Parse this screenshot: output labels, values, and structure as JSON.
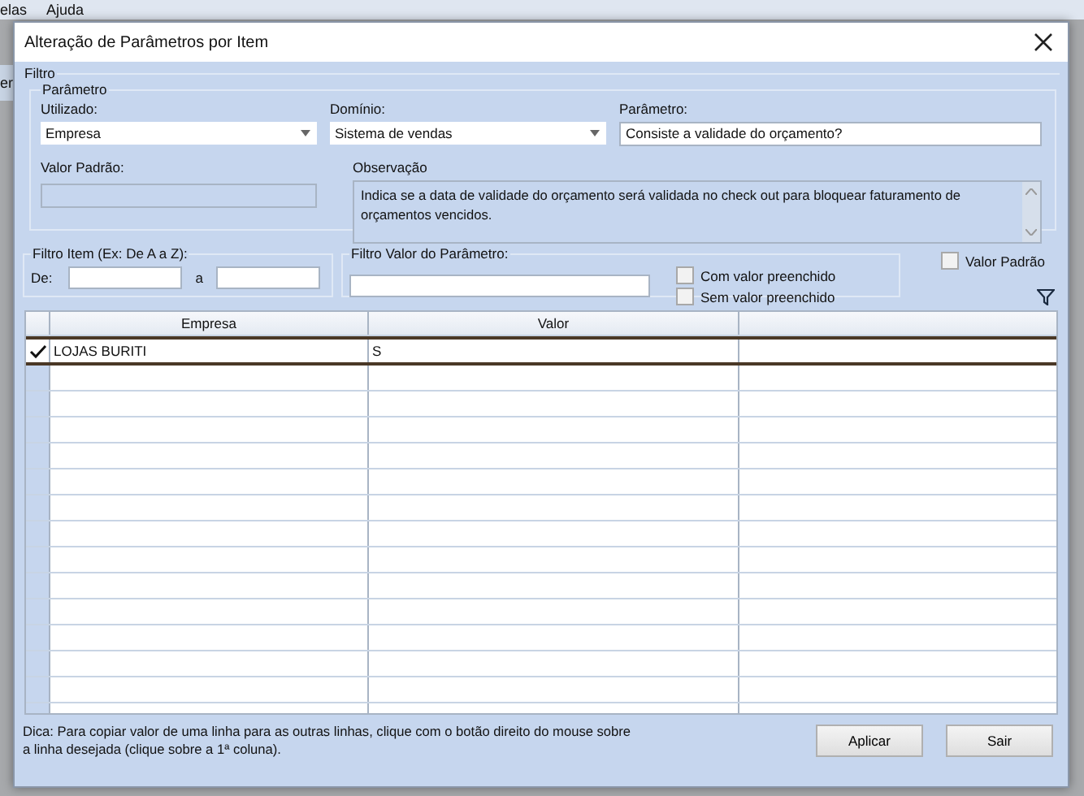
{
  "background_menu": [
    "elas",
    "Ajuda"
  ],
  "background_side_text": "er",
  "window": {
    "title": "Alteração de Parâmetros por Item"
  },
  "filtro": {
    "label": "Filtro",
    "parametro": {
      "label": "Parâmetro",
      "utilizado": {
        "label": "Utilizado:",
        "value": "Empresa"
      },
      "dominio": {
        "label": "Domínio:",
        "value": "Sistema de vendas"
      },
      "parametro_field": {
        "label": "Parâmetro:",
        "value": "Consiste a validade do orçamento?"
      },
      "valor_padrao": {
        "label": "Valor Padrão:",
        "disabled": true
      },
      "observacao": {
        "label": "Observação",
        "value": "Indica se a data de validade do orçamento será validada no check out para bloquear faturamento de orçamentos vencidos."
      }
    }
  },
  "filtro_item": {
    "label": "Filtro Item (Ex: De A a Z):",
    "de_label": "De:",
    "a_label": "a"
  },
  "filtro_valor": {
    "label": "Filtro Valor do Parâmetro:",
    "options": [
      {
        "label": "Com valor preenchido",
        "checked": false
      },
      {
        "label": "Sem valor preenchido",
        "checked": false
      }
    ]
  },
  "valor_padrao_check": {
    "label": "Valor Padrão",
    "checked": false
  },
  "table": {
    "columns": [
      "Empresa",
      "Valor"
    ],
    "rows": [
      {
        "cells": [
          "LOJAS BURITI",
          "S"
        ],
        "selected": true
      }
    ]
  },
  "hint": "Dica: Para copiar valor de uma linha para as outras linhas, clique com o botão direito do mouse sobre a linha desejada (clique sobre a 1ª coluna).",
  "buttons": [
    "Aplicar",
    "Sair"
  ]
}
